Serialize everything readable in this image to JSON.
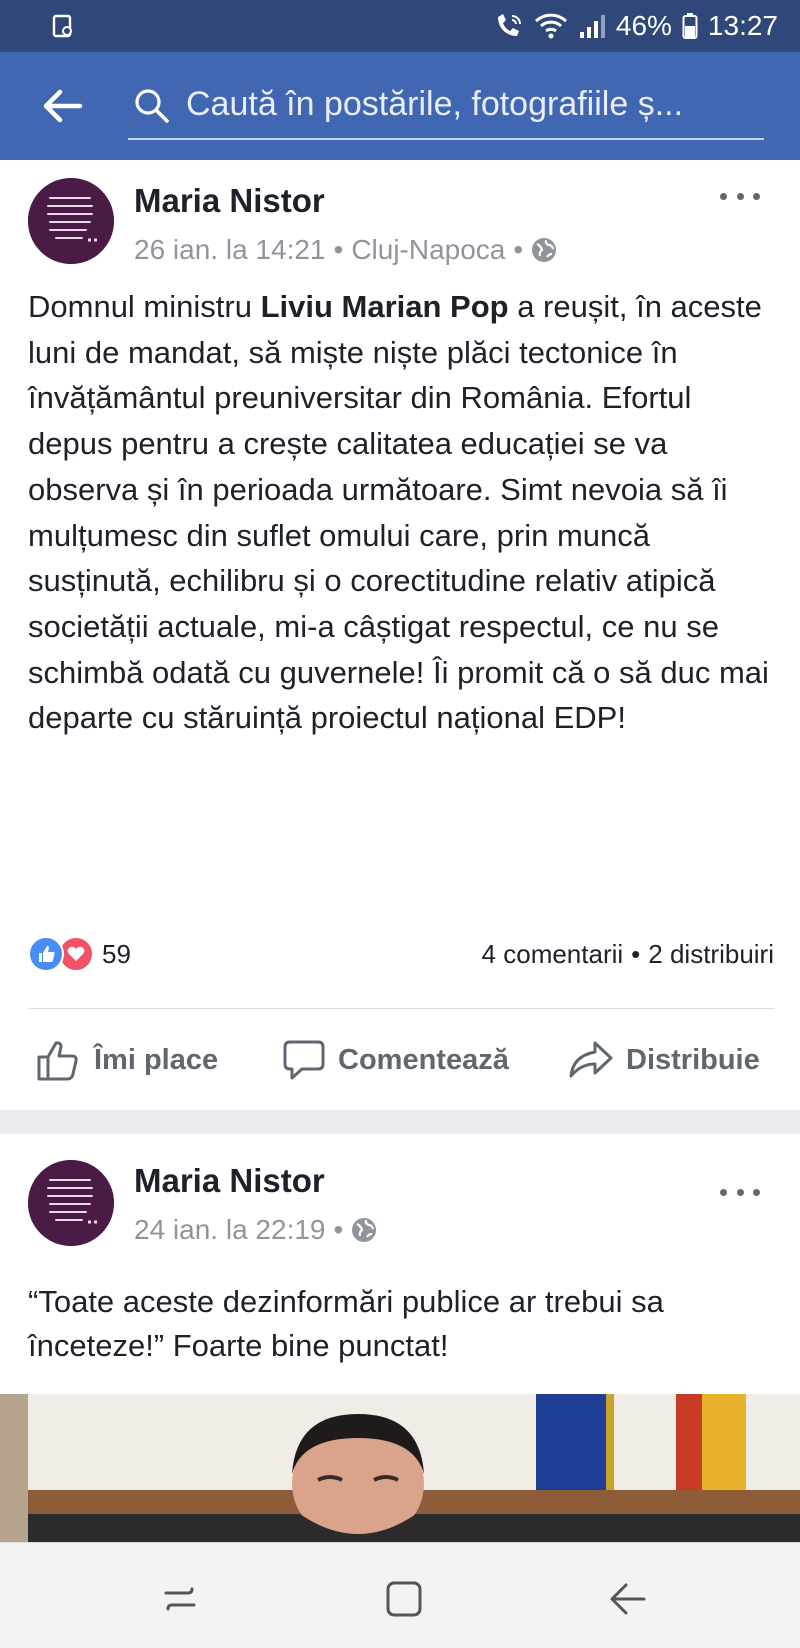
{
  "status_bar": {
    "left_icon": "screen-record-icon",
    "icons": [
      "wifi-calling-icon",
      "wifi-icon",
      "signal-icon",
      "battery-icon"
    ],
    "battery": "46%",
    "time": "13:27"
  },
  "header": {
    "back_icon": "arrow-left-icon",
    "search_icon": "magnifier-icon",
    "search_placeholder": "Caută în postările, fotografiile ș..."
  },
  "posts": [
    {
      "author": "Maria Nistor",
      "date": "26 ian. la 14:21",
      "location": "Cluj-Napoca",
      "separator": "•",
      "privacy_icon": "globe-icon",
      "text_before": "Domnul ministru ",
      "text_bold": "Liviu Marian Pop",
      "text_after": " a reușit, în aceste luni de mandat, să miște niște plăci tectonice în învățământul preuniversitar din România. Efortul depus pentru a crește calitatea educației se va observa și în perioada următoare. Simt nevoia să îi mulțumesc din suflet omului care, prin muncă susținută, echilibru și o corectitudine relativ atipică societății actuale, mi-a câștigat respectul, ce nu se schimbă odată cu guvernele! Îi promit că o să duc mai departe cu stăruință proiectul național EDP!",
      "reaction_count": "59",
      "comments": "4 comentarii",
      "shares": "2 distribuiri",
      "actions": {
        "like": "Îmi place",
        "comment": "Comentează",
        "share": "Distribuie"
      }
    },
    {
      "author": "Maria Nistor",
      "date": "24 ian. la 22:19",
      "separator": "•",
      "privacy_icon": "globe-icon",
      "text": "“Toate aceste dezinformări publice ar trebui sa înceteze!” Foarte bine punctat!"
    }
  ],
  "nav_bar": {
    "icons": [
      "recent-apps-icon",
      "home-icon",
      "back-icon"
    ]
  },
  "colors": {
    "status_bar": "#2f4779",
    "header": "#4267b2",
    "text": "#1d2129",
    "meta": "#90949c",
    "like": "#4a8cf5",
    "love": "#f25268"
  }
}
